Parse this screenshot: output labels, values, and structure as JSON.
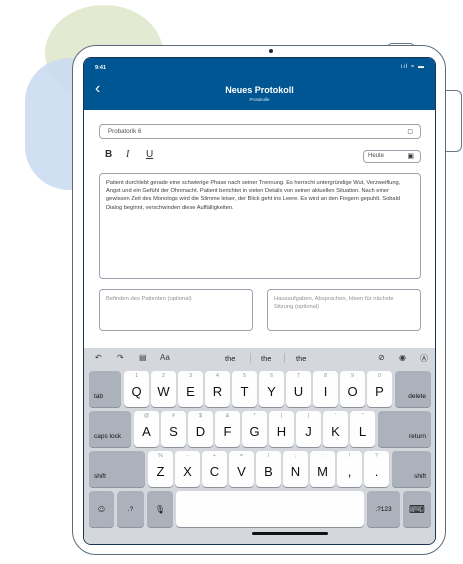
{
  "status": {
    "time": "9:41",
    "icons": "ııl ≈ ▬"
  },
  "nav": {
    "back": "‹",
    "title": "Neues Protokoll",
    "subtitle": "Protokolle"
  },
  "form": {
    "type_value": "Probatorik 6",
    "format": {
      "bold": "B",
      "italic": "I",
      "underline": "U"
    },
    "date_value": "Heute",
    "notes": "Patient durchlebt gerade eine schwierige Phase nach seiner Trennung. Es herrscht untergründige Wut, Verzweiflung, Angst und ein Gefühl der Ohnmacht. Patient berichtet in vielen Details von seiner aktuellen Situation. Nach einer gewissen Zeit des Monologs wird die Stimme leiser, der Blick geht ins Leere. Es wird an den Fingern gepuhlt. Sobald Dialog beginnt, verschwinden diese Auffälligkeiten.",
    "befinden_placeholder": "Befinden des Patienten (optional)",
    "hausaufgaben_placeholder": "Hausaufgaben, Absprachen, Ideen für nächste Sitzung (optional)"
  },
  "keyboard": {
    "toolbar": {
      "undo": "↶",
      "redo": "↷",
      "paste": "▤",
      "format": "Aa",
      "check": "⊘",
      "camera": "◉",
      "scribble": "Ⓐ"
    },
    "suggestions": [
      "the",
      "the",
      "the"
    ],
    "row1_hints": [
      "1",
      "2",
      "3",
      "4",
      "5",
      "6",
      "7",
      "8",
      "9",
      "0"
    ],
    "row1": [
      "Q",
      "W",
      "E",
      "R",
      "T",
      "Y",
      "U",
      "I",
      "O",
      "P"
    ],
    "row2_hints": [
      "@",
      "#",
      "$",
      "&",
      "*",
      "(",
      ")",
      "'",
      "\""
    ],
    "row2": [
      "A",
      "S",
      "D",
      "F",
      "G",
      "H",
      "J",
      "K",
      "L"
    ],
    "row3_hints": [
      "%",
      "-",
      "+",
      "=",
      "/",
      ";",
      ":",
      "!",
      "?"
    ],
    "row3": [
      "Z",
      "X",
      "C",
      "V",
      "B",
      "N",
      "M",
      ",",
      "."
    ],
    "tab": "tab",
    "delete": "delete",
    "caps_lock": "caps lock",
    "return": "return",
    "shift": "shift",
    "emoji": "☺",
    "num_left": ".?",
    "mic": "🎙",
    "num_right": ".?123",
    "hide": "⌨"
  }
}
